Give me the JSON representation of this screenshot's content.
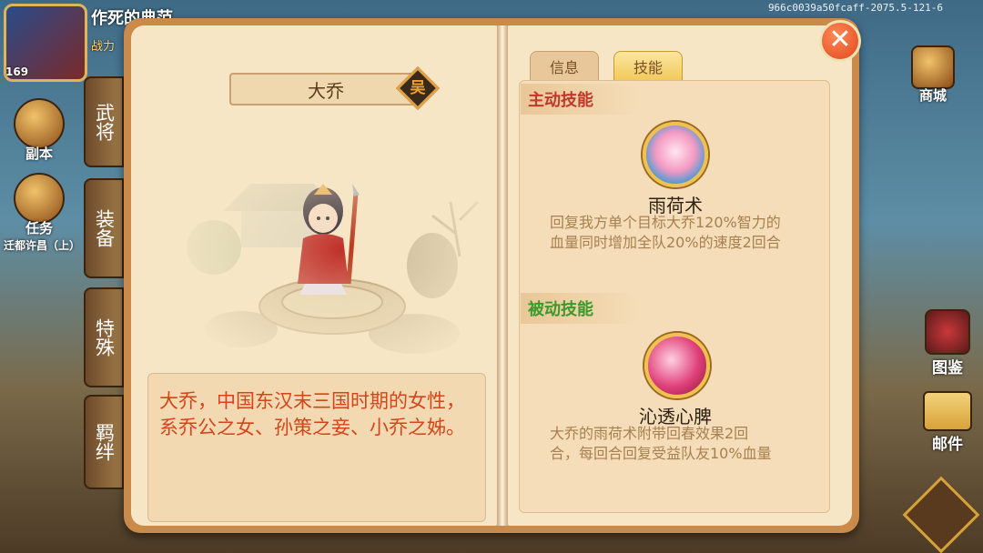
{
  "watermark": "966c0039a50fcaff-2075.5-121-6",
  "hud": {
    "level": "169",
    "player_name": "作死的典范",
    "player_sub": "战力",
    "left_buttons": [
      {
        "label": "副本",
        "icon": "sword-shield-icon"
      },
      {
        "label": "任务",
        "icon": "scroll-icon"
      }
    ],
    "quest_text": "迁都许昌（上）",
    "side_tabs": [
      "武将",
      "装备",
      "特殊",
      "羁绊"
    ],
    "right_buttons": [
      {
        "label": "商城",
        "icon": "shop-icon"
      },
      {
        "label": "图鉴",
        "icon": "catalog-icon"
      },
      {
        "label": "邮件",
        "icon": "mail-icon"
      }
    ]
  },
  "hero": {
    "name": "大乔",
    "faction": "吴",
    "description": "大乔，中国东汉末三国时期的女性，系乔公之女、孙策之妾、小乔之姊。"
  },
  "tabs": [
    {
      "label": "信息",
      "active": false
    },
    {
      "label": "技能",
      "active": true
    }
  ],
  "active_skill": {
    "section_label": "主动技能",
    "name": "雨荷术",
    "icon": "lotus-icon",
    "description_lines": [
      "回复我方单个目标大乔120%智力的",
      "血量同时增加全队20%的速度2回合"
    ]
  },
  "passive_skill": {
    "section_label": "被动技能",
    "name": "沁透心脾",
    "icon": "heart-icon",
    "description_lines": [
      "大乔的雨荷术附带回春效果2回",
      "合，每回合回复受益队友10%血量"
    ]
  },
  "colors": {
    "active_header": "#c0392b",
    "passive_header": "#3a9a2a",
    "description_text": "#d4451a",
    "skill_desc_text": "#a8804f",
    "close_button": "#e0461a"
  }
}
